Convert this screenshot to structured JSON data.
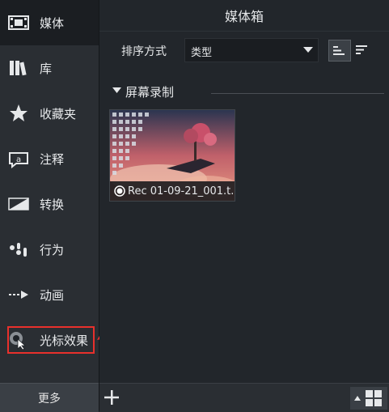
{
  "sidebar": {
    "items": [
      {
        "label": "媒体",
        "icon": "film-strip-icon"
      },
      {
        "label": "库",
        "icon": "books-icon"
      },
      {
        "label": "收藏夹",
        "icon": "star-icon"
      },
      {
        "label": "注释",
        "icon": "callout-icon"
      },
      {
        "label": "转换",
        "icon": "transition-icon"
      },
      {
        "label": "行为",
        "icon": "behavior-icon"
      },
      {
        "label": "动画",
        "icon": "animation-arrow-icon"
      },
      {
        "label": "光标效果",
        "icon": "cursor-effect-icon"
      }
    ],
    "more_label": "更多",
    "active": "媒体"
  },
  "main": {
    "title": "媒体箱",
    "sort_label": "排序方式",
    "sort_value": "类型",
    "section_title": "屏幕录制",
    "clip": {
      "name": "Rec 01-09-21_001.t..."
    }
  },
  "colors": {
    "highlight": "#e8302c",
    "accent": "#4ea3e8"
  }
}
